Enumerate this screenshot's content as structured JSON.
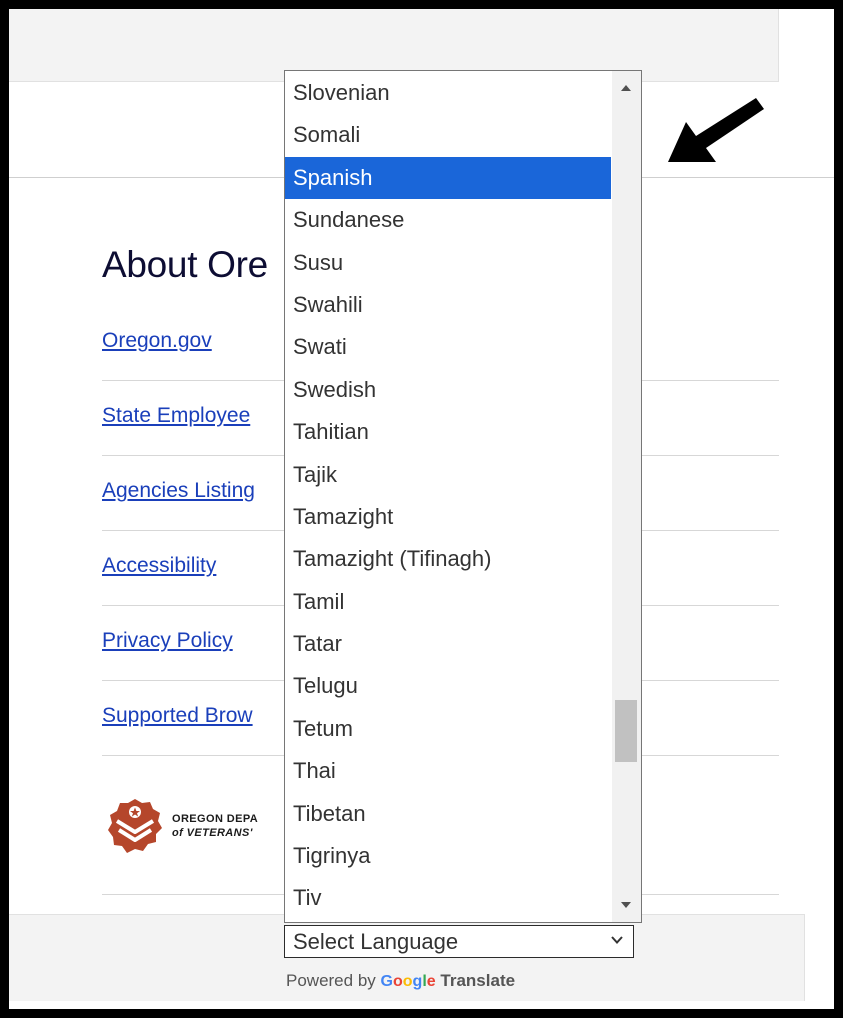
{
  "about": {
    "heading": "About Ore"
  },
  "footer_links": [
    "Oregon.gov",
    "State Employee",
    "Agencies Listing",
    "Accessibility",
    "Privacy Policy",
    "Supported Brow"
  ],
  "logo": {
    "line1": "OREGON DEPA",
    "line2": "of VETERANS'"
  },
  "language_dropdown": {
    "options": [
      "Slovenian",
      "Somali",
      "Spanish",
      "Sundanese",
      "Susu",
      "Swahili",
      "Swati",
      "Swedish",
      "Tahitian",
      "Tajik",
      "Tamazight",
      "Tamazight (Tifinagh)",
      "Tamil",
      "Tatar",
      "Telugu",
      "Tetum",
      "Thai",
      "Tibetan",
      "Tigrinya",
      "Tiv"
    ],
    "selected": "Spanish",
    "scroll_position": 0.82
  },
  "translate": {
    "select_label": "Select Language",
    "powered_by": "Powered by",
    "google": [
      "G",
      "o",
      "o",
      "g",
      "l",
      "e"
    ],
    "google_colors": [
      "#4285f4",
      "#ea4335",
      "#fbbc05",
      "#4285f4",
      "#34a853",
      "#ea4335"
    ],
    "product": "Translate"
  },
  "colors": {
    "selection": "#1a66d9",
    "link": "#1a3fba",
    "logo": "#b5462b"
  },
  "icons": [
    "arrow-pointer-icon",
    "oregon-veterans-logo-icon",
    "chevron-down-icon"
  ]
}
